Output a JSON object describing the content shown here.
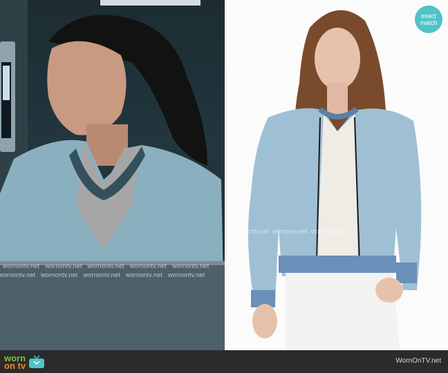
{
  "badge": {
    "line1": "exact",
    "line2": "match"
  },
  "watermark": {
    "row": [
      "wornontv.net",
      "wornontv.net",
      "wornontv.net",
      "wornontv.net",
      "wornontv.net"
    ],
    "right_row": [
      "wornontv.net",
      "wornontv.net",
      "wornontv.net"
    ]
  },
  "footer": {
    "brand_top": "worn",
    "brand_bottom": "on tv",
    "credit": "WornOnTV.net"
  },
  "colors": {
    "badge": "#4fc3c8",
    "brand_green": "#7cc242",
    "brand_orange": "#f08a24",
    "jacket": "#9fc0d4"
  },
  "icons": [
    "tv-icon"
  ]
}
